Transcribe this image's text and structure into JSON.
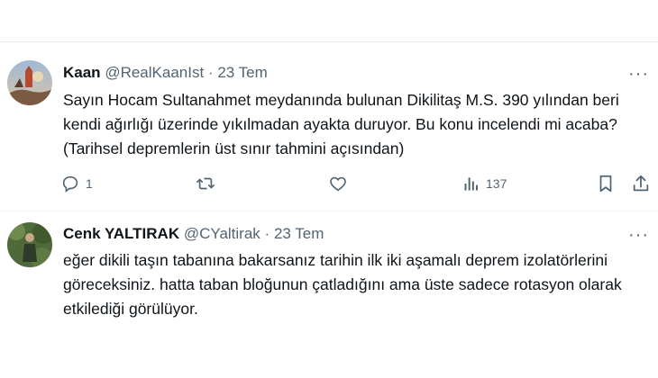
{
  "tweets": [
    {
      "name": "Kaan",
      "handle": "@RealKaanIst",
      "separator": "·",
      "date": "23 Tem",
      "text": "Sayın Hocam Sultanahmet meydanında bulunan Dikilitaş M.S. 390 yılından beri kendi ağırlığı üzerinde yıkılmadan ayakta duruyor. Bu konu incelendi mi acaba? (Tarihsel depremlerin üst sınır tahmini açısından)",
      "more": "···",
      "actions": {
        "reply_count": "1",
        "retweet_count": "",
        "like_count": "",
        "views_count": "137"
      },
      "icons": [
        "reply-icon",
        "retweet-icon",
        "like-icon",
        "views-icon",
        "bookmark-icon",
        "share-icon"
      ]
    },
    {
      "name": "Cenk YALTIRAK",
      "handle": "@CYaltirak",
      "separator": "·",
      "date": "23 Tem",
      "text": "eğer dikili taşın tabanına bakarsanız tarihin ilk iki aşamalı deprem izolatörlerini göreceksiniz. hatta taban bloğunun çatladığını ama üste sadece rotasyon olarak etkilediği görülüyor.",
      "more": "···"
    }
  ],
  "colors": {
    "text": "#0f1419",
    "secondary": "#536471",
    "divider": "#eff3f4"
  }
}
